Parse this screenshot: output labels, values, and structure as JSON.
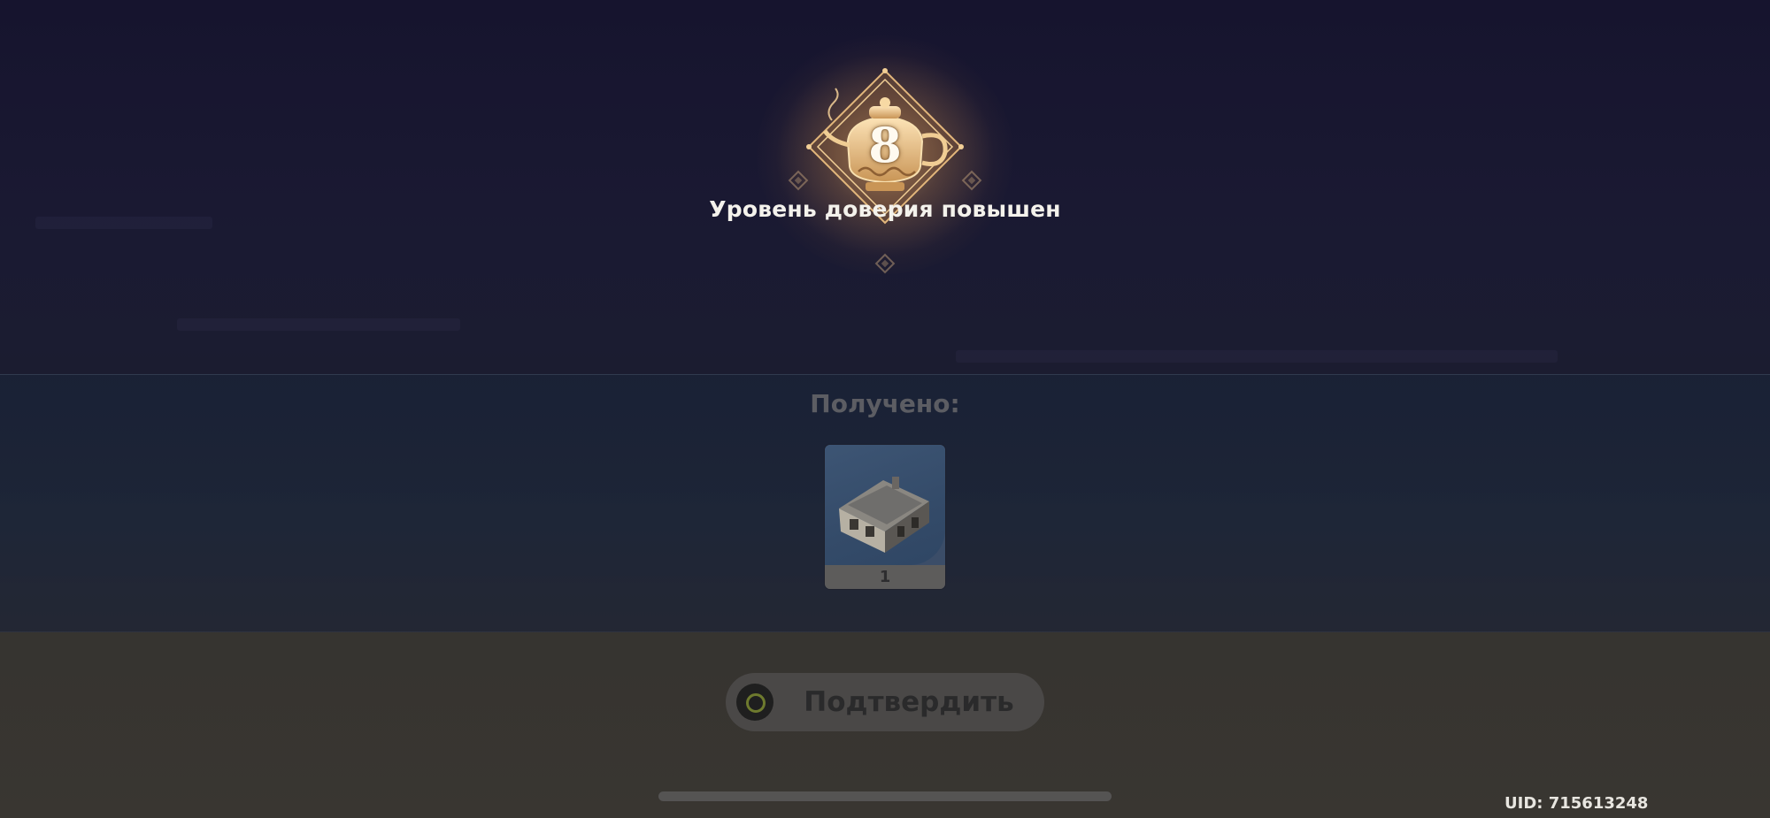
{
  "popup": {
    "level": "8",
    "title": "Уровень доверия повышен"
  },
  "rewards": {
    "label": "Получено:",
    "items": [
      {
        "name": "house",
        "count": "1"
      }
    ]
  },
  "confirm": {
    "label": "Подтвердить"
  },
  "footer": {
    "uid": "UID: 715613248"
  },
  "colors": {
    "accent_gold": "#e8c48a",
    "title_text": "#f4f2ec",
    "item_bg": "#3d5574"
  },
  "icons": {
    "emblem": "teapot-emblem-icon",
    "confirm": "circle-button-icon",
    "item": "house-icon"
  }
}
